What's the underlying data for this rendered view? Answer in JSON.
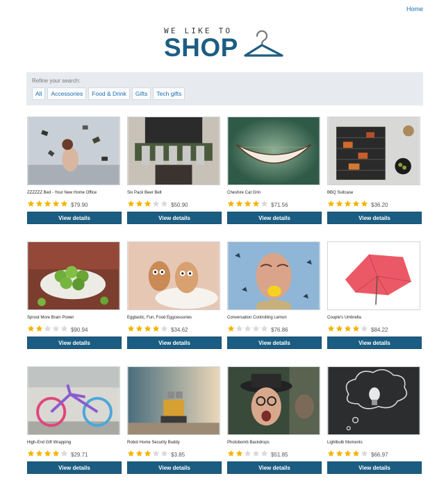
{
  "nav": {
    "home": "Home"
  },
  "logo": {
    "tagline": "WE LIKE TO",
    "word": "SHOP"
  },
  "refine": {
    "label": "Refine your search:",
    "filters": [
      "All",
      "Accessories",
      "Food & Drink",
      "Gifts",
      "Tech gifts"
    ]
  },
  "colors": {
    "brand": "#1d5d82",
    "button": "#1b5d82",
    "star_on": "#f5b400",
    "star_off": "#d9d9d9",
    "link": "#1a6fae"
  },
  "products": [
    {
      "name": "ZZZZZZ Bed - Your New Home Office",
      "rating": 5,
      "price": "$79.90",
      "button": "View details",
      "image_icon": "floating-books-image"
    },
    {
      "name": "Six Pack Beer Belt",
      "rating": 3,
      "price": "$50.90",
      "button": "View details",
      "image_icon": "beer-belt-image"
    },
    {
      "name": "Cheshire Cat Grin",
      "rating": 4,
      "price": "$71.56",
      "button": "View details",
      "image_icon": "grin-image"
    },
    {
      "name": "BBQ Suitcase",
      "rating": 5,
      "price": "$36.20",
      "button": "View details",
      "image_icon": "bbq-grill-image"
    },
    {
      "name": "Sprout More Brain Power",
      "rating": 2,
      "price": "$90.94",
      "button": "View details",
      "image_icon": "sprouts-image"
    },
    {
      "name": "Eggtastic, Fun, Food Eggcessories",
      "rating": 4,
      "price": "$34.62",
      "button": "View details",
      "image_icon": "eggs-image"
    },
    {
      "name": "Conversation Controlling Lemon",
      "rating": 1,
      "price": "$76.86",
      "button": "View details",
      "image_icon": "lemon-mouth-image"
    },
    {
      "name": "Couple's Umbrella",
      "rating": 4,
      "price": "$84.22",
      "button": "View details",
      "image_icon": "red-umbrella-image"
    },
    {
      "name": "High-End Gift Wrapping",
      "rating": 4,
      "price": "$29.71",
      "button": "View details",
      "image_icon": "knitted-bicycle-image"
    },
    {
      "name": "Robot Home Security Buddy",
      "rating": 3,
      "price": "$3.85",
      "button": "View details",
      "image_icon": "robot-toy-image"
    },
    {
      "name": "Photobomb Backdrops",
      "rating": 2,
      "price": "$51.85",
      "button": "View details",
      "image_icon": "photobomb-image"
    },
    {
      "name": "Lightbulb Moments",
      "rating": 4,
      "price": "$66.97",
      "button": "View details",
      "image_icon": "lightbulb-chalk-image"
    }
  ]
}
